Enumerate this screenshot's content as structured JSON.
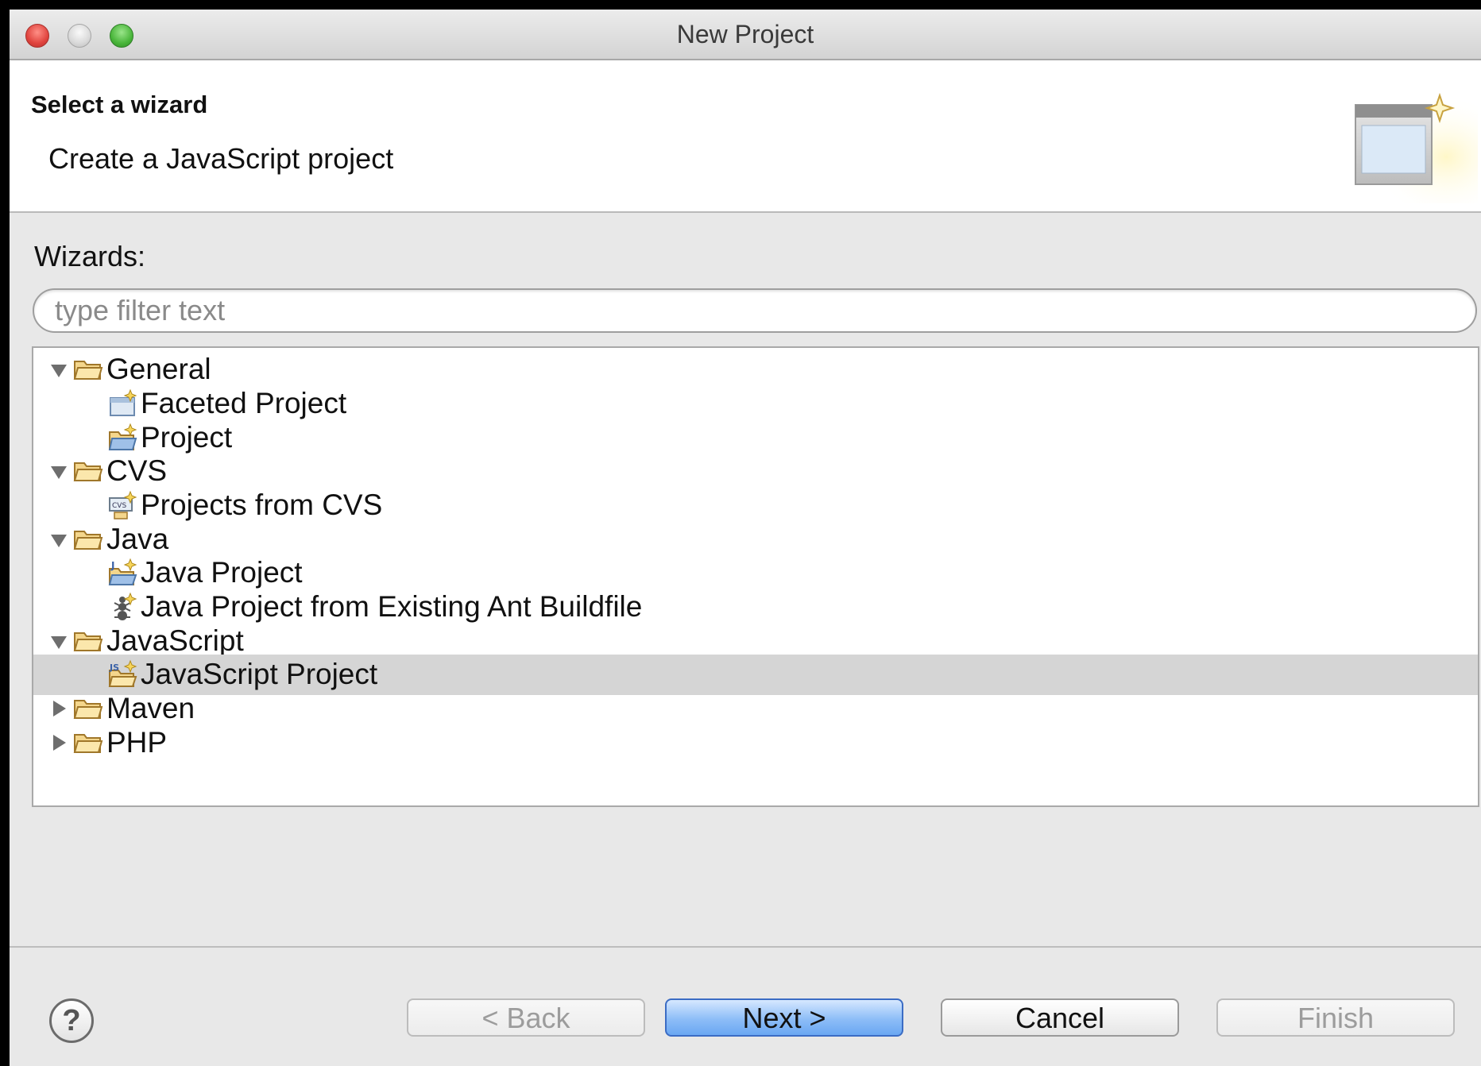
{
  "window": {
    "title": "New Project"
  },
  "header": {
    "heading": "Select a wizard",
    "description": "Create a JavaScript project"
  },
  "wizards": {
    "label": "Wizards:",
    "filter_placeholder": "type filter text",
    "tree": [
      {
        "label": "General",
        "type": "category",
        "expanded": true,
        "icon": "folder-icon"
      },
      {
        "label": "Faceted Project",
        "type": "item",
        "icon": "faceted-project-icon"
      },
      {
        "label": "Project",
        "type": "item",
        "icon": "project-icon"
      },
      {
        "label": "CVS",
        "type": "category",
        "expanded": true,
        "icon": "folder-icon"
      },
      {
        "label": "Projects from CVS",
        "type": "item",
        "icon": "cvs-project-icon"
      },
      {
        "label": "Java",
        "type": "category",
        "expanded": true,
        "icon": "folder-icon"
      },
      {
        "label": "Java Project",
        "type": "item",
        "icon": "java-project-icon"
      },
      {
        "label": "Java Project from Existing Ant Buildfile",
        "type": "item",
        "icon": "ant-icon"
      },
      {
        "label": "JavaScript",
        "type": "category",
        "expanded": true,
        "icon": "folder-icon"
      },
      {
        "label": "JavaScript Project",
        "type": "item",
        "icon": "javascript-project-icon",
        "selected": true
      },
      {
        "label": "Maven",
        "type": "category",
        "expanded": false,
        "icon": "folder-icon"
      },
      {
        "label": "PHP",
        "type": "category",
        "expanded": false,
        "icon": "folder-icon"
      }
    ]
  },
  "buttons": {
    "help": "?",
    "back": "< Back",
    "next": "Next >",
    "cancel": "Cancel",
    "finish": "Finish"
  },
  "colors": {
    "selection": "#d5d5d5",
    "default_button": "#8dbdf7"
  }
}
